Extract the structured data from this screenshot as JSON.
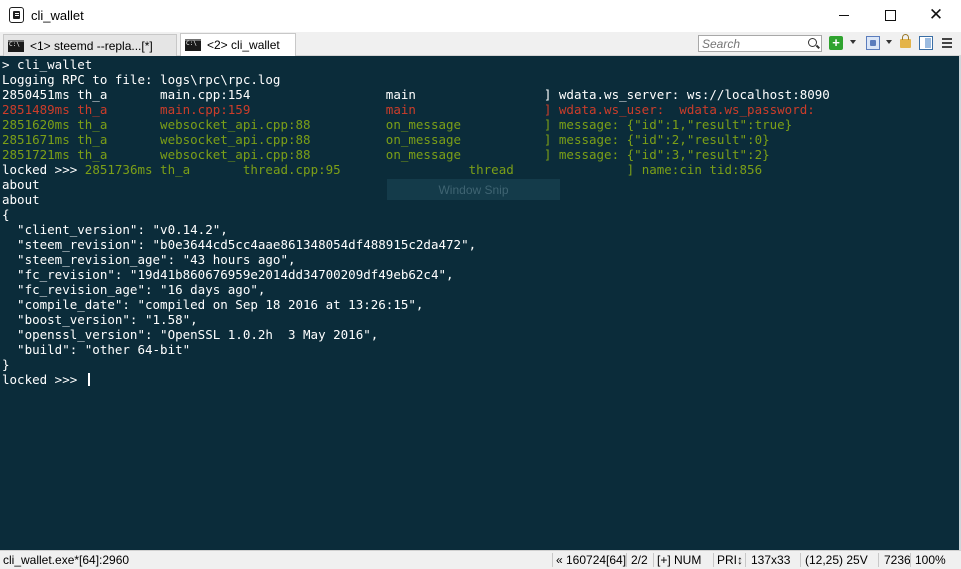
{
  "window": {
    "title": "cli_wallet",
    "buttons": {
      "minimize": "—",
      "maximize": "□",
      "close": "✕"
    }
  },
  "tabs": [
    {
      "label": "<1> steemd  --repla...[*]",
      "active": false
    },
    {
      "label": "<2> cli_wallet",
      "active": true
    }
  ],
  "toolbar": {
    "search_placeholder": "Search"
  },
  "console": {
    "background": "#0b2c3a",
    "colors": {
      "text": "#ffffff",
      "error": "#cc3d2a",
      "log": "#7c9f17"
    },
    "lines": [
      [
        {
          "t": "> cli_wallet",
          "c": "white"
        }
      ],
      [
        {
          "t": "Logging RPC to file: logs\\rpc\\rpc.log",
          "c": "white"
        }
      ],
      [
        {
          "t": "2850451ms th_a       main.cpp:154                  main                 ] wdata.ws_server: ws://localhost:8090",
          "c": "white"
        }
      ],
      [
        {
          "t": "2851489ms th_a       main.cpp:159                  main                 ] wdata.ws_user:  wdata.ws_password:",
          "c": "red"
        }
      ],
      [
        {
          "t": "2851620ms th_a       websocket_api.cpp:88          on_message           ] message: {\"id\":1,\"result\":true}",
          "c": "green"
        }
      ],
      [
        {
          "t": "2851671ms th_a       websocket_api.cpp:88          on_message           ] message: {\"id\":2,\"result\":0}",
          "c": "green"
        }
      ],
      [
        {
          "t": "2851721ms th_a       websocket_api.cpp:88          on_message           ] message: {\"id\":3,\"result\":2}",
          "c": "green"
        }
      ],
      [
        {
          "t": "locked >>> ",
          "c": "white"
        },
        {
          "t": "2851736ms th_a       thread.cpp:95                 thread               ] name:cin tid:856",
          "c": "green"
        }
      ],
      [
        {
          "t": "about",
          "c": "white"
        }
      ],
      [
        {
          "t": "about",
          "c": "white"
        }
      ],
      [
        {
          "t": "{",
          "c": "white"
        }
      ],
      [
        {
          "t": "  \"client_version\": \"v0.14.2\",",
          "c": "white"
        }
      ],
      [
        {
          "t": "  \"steem_revision\": \"b0e3644cd5cc4aae861348054df488915c2da472\",",
          "c": "white"
        }
      ],
      [
        {
          "t": "  \"steem_revision_age\": \"43 hours ago\",",
          "c": "white"
        }
      ],
      [
        {
          "t": "  \"fc_revision\": \"19d41b860676959e2014dd34700209df49eb62c4\",",
          "c": "white"
        }
      ],
      [
        {
          "t": "  \"fc_revision_age\": \"16 days ago\",",
          "c": "white"
        }
      ],
      [
        {
          "t": "  \"compile_date\": \"compiled on Sep 18 2016 at 13:26:15\",",
          "c": "white"
        }
      ],
      [
        {
          "t": "  \"boost_version\": \"1.58\",",
          "c": "white"
        }
      ],
      [
        {
          "t": "  \"openssl_version\": \"OpenSSL 1.0.2h  3 May 2016\",",
          "c": "white"
        }
      ],
      [
        {
          "t": "  \"build\": \"other 64-bit\"",
          "c": "white"
        }
      ],
      [
        {
          "t": "}",
          "c": "white"
        }
      ],
      [
        {
          "t": "locked >>> ",
          "c": "white",
          "cursor": true
        }
      ]
    ],
    "overlay_label": "Window Snip"
  },
  "status": {
    "process": "cli_wallet.exe*[64]:2960",
    "pid": "« 160724[64]",
    "console_index": "2/2",
    "insert": "[+] NUM",
    "pri": "PRI↕",
    "size": "137x33",
    "cursor_pos": "(12,25) 25V",
    "buffer": "7236",
    "zoom": "100%"
  }
}
